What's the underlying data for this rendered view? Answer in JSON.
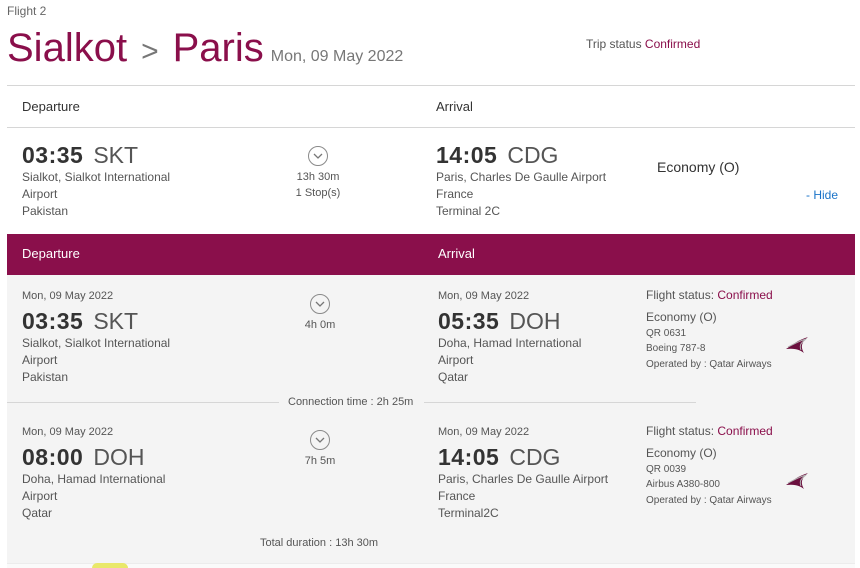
{
  "flight_label": "Flight 2",
  "route": {
    "origin": "Sialkot",
    "separator": ">",
    "destination": "Paris",
    "date": "Mon, 09 May 2022"
  },
  "trip_status": {
    "label": "Trip status",
    "value": "Confirmed"
  },
  "summary": {
    "departure_header": "Departure",
    "arrival_header": "Arrival",
    "dep_time": "03:35",
    "dep_code": "SKT",
    "dep_line1": "Sialkot, Sialkot International",
    "dep_line2": "Airport",
    "dep_line3": "Pakistan",
    "duration": "13h 30m",
    "stops": "1 Stop(s)",
    "arr_time": "14:05",
    "arr_code": "CDG",
    "arr_line1": "Paris, Charles De Gaulle Airport",
    "arr_line2": "France",
    "arr_line3": "Terminal 2C",
    "cabin": "Economy (O)",
    "hide_link": "- Hide"
  },
  "detail_header": {
    "departure": "Departure",
    "arrival": "Arrival"
  },
  "segments": [
    {
      "dep_date": "Mon, 09 May 2022",
      "dep_time": "03:35",
      "dep_code": "SKT",
      "dep_line1": "Sialkot, Sialkot International",
      "dep_line2": "Airport",
      "dep_line3": "Pakistan",
      "duration": "4h 0m",
      "arr_date": "Mon, 09 May 2022",
      "arr_time": "05:35",
      "arr_code": "DOH",
      "arr_line1": "Doha, Hamad International",
      "arr_line2": "Airport",
      "arr_line3": "Qatar",
      "status_label": "Flight status:",
      "status_value": "Confirmed",
      "cabin": "Economy (O)",
      "flight_no": "QR 0631",
      "aircraft": "Boeing 787-8",
      "operated_by": "Operated by : Qatar Airways"
    },
    {
      "dep_date": "Mon, 09 May 2022",
      "dep_time": "08:00",
      "dep_code": "DOH",
      "dep_line1": "Doha, Hamad International",
      "dep_line2": "Airport",
      "dep_line3": "Qatar",
      "duration": "7h 5m",
      "arr_date": "Mon, 09 May 2022",
      "arr_time": "14:05",
      "arr_code": "CDG",
      "arr_line1": "Paris, Charles De Gaulle Airport",
      "arr_line2": "France",
      "arr_line3": "Terminal2C",
      "status_label": "Flight status:",
      "status_value": "Confirmed",
      "cabin": "Economy (O)",
      "flight_no": "QR 0039",
      "aircraft": "Airbus A380-800",
      "operated_by": "Operated by : Qatar Airways"
    }
  ],
  "connection_time": "Connection time : 2h 25m",
  "total_duration": "Total duration : 13h 30m",
  "colors": {
    "brand": "#8a0f4b",
    "link": "#1a73c8"
  },
  "icons": {
    "duration": "chevron-down-circle-icon",
    "airline": "qatar-airways-logo"
  }
}
